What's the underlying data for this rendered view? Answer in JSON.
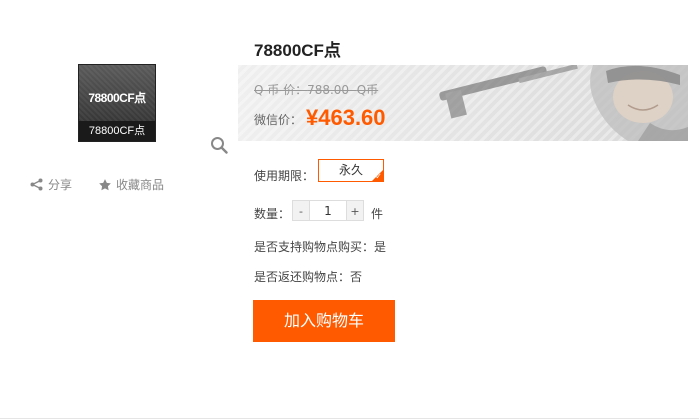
{
  "product": {
    "thumbnail_text": "78800CF点",
    "thumbnail_caption": "78800CF点",
    "title": "78800CF点"
  },
  "actions": {
    "share_label": "分享",
    "favorite_label": "收藏商品"
  },
  "price": {
    "q_price_label": "Q 币 价：",
    "q_price_value": "788.00",
    "q_price_unit": "Q币",
    "wechat_label": "微信价：",
    "wechat_value": "¥463.60"
  },
  "options": {
    "period_label": "使用期限：",
    "period_value": "永久",
    "quantity_label": "数量：",
    "quantity_minus": "-",
    "quantity_value": "1",
    "quantity_plus": "+",
    "quantity_unit": "件",
    "support_points_text": "是否支持购物点购买：是",
    "return_points_text": "是否返还购物点：否"
  },
  "cart": {
    "add_to_cart_label": "加入购物车"
  },
  "colors": {
    "accent": "#ff5a00"
  }
}
